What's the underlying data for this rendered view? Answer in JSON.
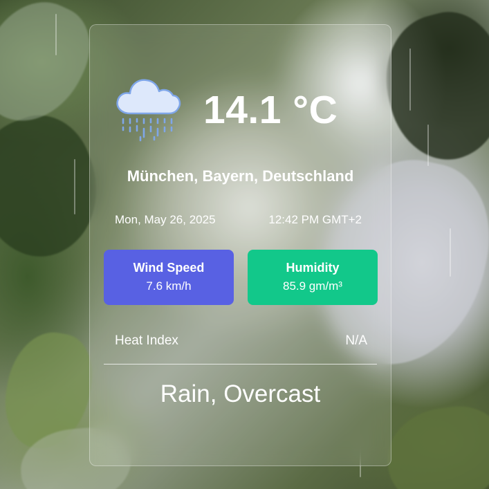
{
  "weather": {
    "icon": "rain-cloud-icon",
    "temperature": "14.1 °C",
    "location": "München, Bayern, Deutschland",
    "date": "Mon, May 26, 2025",
    "time": "12:42 PM GMT+2",
    "wind": {
      "label": "Wind Speed",
      "value": "7.6 km/h",
      "color": "#5861e3"
    },
    "humidity": {
      "label": "Humidity",
      "value": "85.9 gm/m³",
      "color": "#12c88a"
    },
    "heat_index": {
      "label": "Heat Index",
      "value": "N/A"
    },
    "condition": "Rain, Overcast"
  }
}
